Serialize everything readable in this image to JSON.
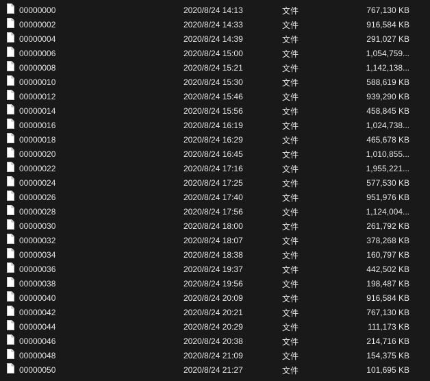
{
  "file_icon": "blank-file-icon",
  "rows": [
    {
      "name": "00000000",
      "date": "2020/8/24 14:13",
      "type": "文件",
      "size": "767,130 KB"
    },
    {
      "name": "00000002",
      "date": "2020/8/24 14:33",
      "type": "文件",
      "size": "916,584 KB"
    },
    {
      "name": "00000004",
      "date": "2020/8/24 14:39",
      "type": "文件",
      "size": "291,027 KB"
    },
    {
      "name": "00000006",
      "date": "2020/8/24 15:00",
      "type": "文件",
      "size": "1,054,759..."
    },
    {
      "name": "00000008",
      "date": "2020/8/24 15:21",
      "type": "文件",
      "size": "1,142,138..."
    },
    {
      "name": "00000010",
      "date": "2020/8/24 15:30",
      "type": "文件",
      "size": "588,619 KB"
    },
    {
      "name": "00000012",
      "date": "2020/8/24 15:46",
      "type": "文件",
      "size": "939,290 KB"
    },
    {
      "name": "00000014",
      "date": "2020/8/24 15:56",
      "type": "文件",
      "size": "458,845 KB"
    },
    {
      "name": "00000016",
      "date": "2020/8/24 16:19",
      "type": "文件",
      "size": "1,024,738..."
    },
    {
      "name": "00000018",
      "date": "2020/8/24 16:29",
      "type": "文件",
      "size": "465,678 KB"
    },
    {
      "name": "00000020",
      "date": "2020/8/24 16:45",
      "type": "文件",
      "size": "1,010,855..."
    },
    {
      "name": "00000022",
      "date": "2020/8/24 17:16",
      "type": "文件",
      "size": "1,955,221..."
    },
    {
      "name": "00000024",
      "date": "2020/8/24 17:25",
      "type": "文件",
      "size": "577,530 KB"
    },
    {
      "name": "00000026",
      "date": "2020/8/24 17:40",
      "type": "文件",
      "size": "951,976 KB"
    },
    {
      "name": "00000028",
      "date": "2020/8/24 17:56",
      "type": "文件",
      "size": "1,124,004..."
    },
    {
      "name": "00000030",
      "date": "2020/8/24 18:00",
      "type": "文件",
      "size": "261,792 KB"
    },
    {
      "name": "00000032",
      "date": "2020/8/24 18:07",
      "type": "文件",
      "size": "378,268 KB"
    },
    {
      "name": "00000034",
      "date": "2020/8/24 18:38",
      "type": "文件",
      "size": "160,797 KB"
    },
    {
      "name": "00000036",
      "date": "2020/8/24 19:37",
      "type": "文件",
      "size": "442,502 KB"
    },
    {
      "name": "00000038",
      "date": "2020/8/24 19:56",
      "type": "文件",
      "size": "198,487 KB"
    },
    {
      "name": "00000040",
      "date": "2020/8/24 20:09",
      "type": "文件",
      "size": "916,584 KB"
    },
    {
      "name": "00000042",
      "date": "2020/8/24 20:21",
      "type": "文件",
      "size": "767,130 KB"
    },
    {
      "name": "00000044",
      "date": "2020/8/24 20:29",
      "type": "文件",
      "size": "111,173 KB"
    },
    {
      "name": "00000046",
      "date": "2020/8/24 20:38",
      "type": "文件",
      "size": "214,716 KB"
    },
    {
      "name": "00000048",
      "date": "2020/8/24 21:09",
      "type": "文件",
      "size": "154,375 KB"
    },
    {
      "name": "00000050",
      "date": "2020/8/24 21:27",
      "type": "文件",
      "size": "101,695 KB"
    }
  ]
}
